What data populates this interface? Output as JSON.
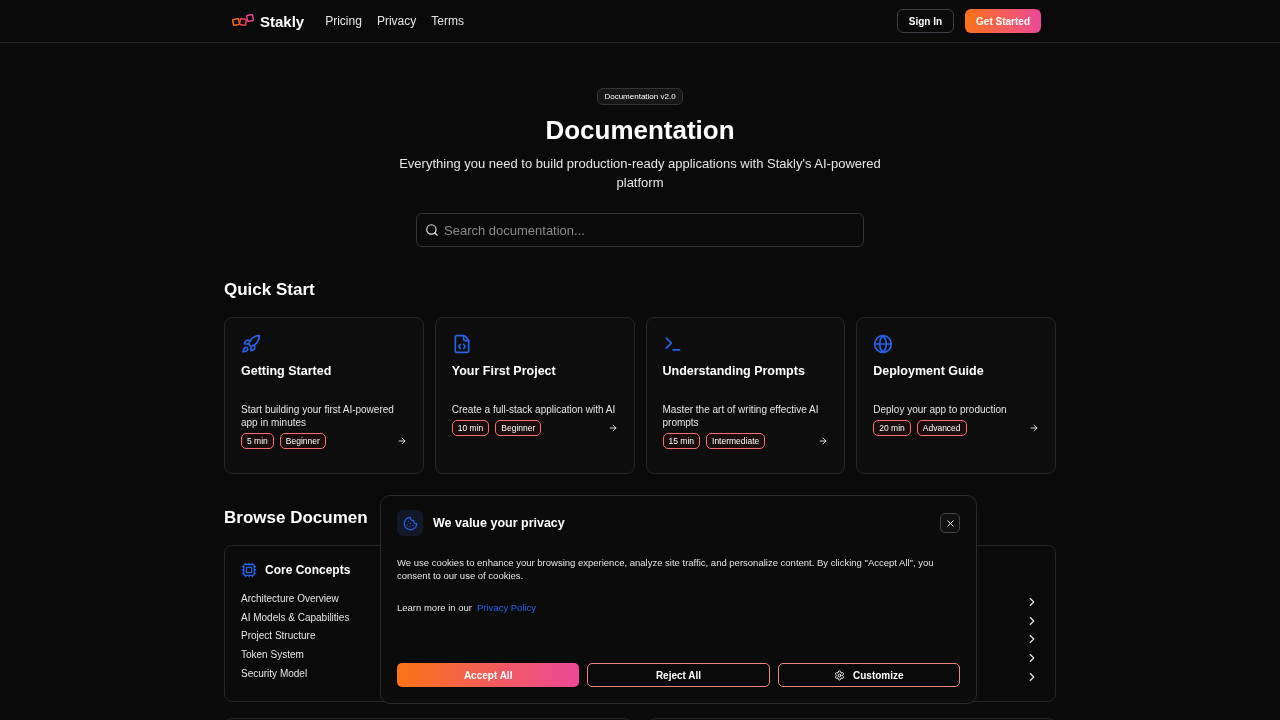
{
  "nav": {
    "brand": "Stakly",
    "links": [
      "Pricing",
      "Privacy",
      "Terms"
    ],
    "sign_in": "Sign In",
    "get_started": "Get Started"
  },
  "hero": {
    "badge": "Documentation v2.0",
    "title": "Documentation",
    "subtitle": "Everything you need to build production-ready applications with Stakly's AI-powered platform",
    "search": {
      "placeholder": "Search documentation..."
    }
  },
  "quick_start": {
    "title": "Quick Start",
    "cards": [
      {
        "kind": "rocket",
        "title": "Getting Started",
        "description": "Start building your first AI-powered app in minutes",
        "duration": "5 min",
        "level_label": "Beginner"
      },
      {
        "kind": "file",
        "title": "Your First Project",
        "description": "Create a full-stack application with AI",
        "duration": "10 min",
        "level_label": "Beginner"
      },
      {
        "kind": "terminal",
        "title": "Understanding Prompts",
        "description": "Master the art of writing effective AI prompts",
        "duration": "15 min",
        "level_label": "Intermediate"
      },
      {
        "kind": "globe",
        "title": "Deployment Guide",
        "description": "Deploy your app to production",
        "duration": "20 min",
        "level_label": "Advanced"
      }
    ]
  },
  "browse": {
    "title": "Browse Documen",
    "section": {
      "title": "Core Concepts",
      "items": [
        "Architecture Overview",
        "AI Models & Capabilities",
        "Project Structure",
        "Token System",
        "Security Model"
      ]
    }
  },
  "cookie_dialog": {
    "title": "We value your privacy",
    "body": "We use cookies to enhance your browsing experience, analyze site traffic, and personalize content. By clicking \"Accept All\", you consent to our use of cookies.",
    "learn_more": "Learn more in our",
    "link": "Privacy Policy",
    "accept": "Accept All",
    "reject": "Reject All",
    "customize": "Customize"
  }
}
